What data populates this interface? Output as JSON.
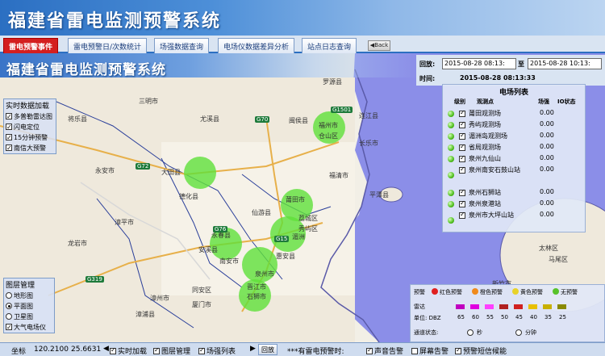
{
  "header": {
    "title": "福建省雷电监测预警系统"
  },
  "tabs": [
    {
      "label": "雷电预警事件",
      "active": true
    },
    {
      "label": "雷电预警日/次数统计"
    },
    {
      "label": "场强数据查询"
    },
    {
      "label": "电场仪数据差异分析"
    },
    {
      "label": "站点日志查询"
    }
  ],
  "back_label": "Back",
  "map": {
    "banner_title": "福建省雷电监测预警系统",
    "places": [
      "三明市",
      "尤溪县",
      "闽侯县",
      "福州市",
      "连江县",
      "仓山区",
      "长乐市",
      "大田县",
      "德化县",
      "福清市",
      "平潭县",
      "仙游县",
      "莆田市",
      "永春县",
      "荔城区",
      "南安市",
      "泉州市",
      "晋江市",
      "石狮市",
      "惠安县",
      "安溪县",
      "秀屿区",
      "同安区",
      "漳浦县",
      "湄洲",
      "漳州市",
      "厦门市",
      "龙岩市",
      "漳平市",
      "永安市",
      "罗源县",
      "将乐县",
      "仓山区",
      "太林区",
      "马尾区",
      "新竹市"
    ],
    "roads": [
      "G70",
      "G1501",
      "G72",
      "G319",
      "G15",
      "G25",
      "G76"
    ]
  },
  "realtime_panel": {
    "title": "实时数据加载",
    "items": [
      {
        "label": "多普勒雷达图",
        "checked": true
      },
      {
        "label": "闪电定位",
        "checked": true
      },
      {
        "label": "15分钟预警",
        "checked": true
      },
      {
        "label": "南信大预警",
        "checked": true
      }
    ]
  },
  "layer_panel": {
    "title": "图层管理",
    "options": [
      {
        "label": "地形图",
        "selected": false
      },
      {
        "label": "平面图",
        "selected": true
      },
      {
        "label": "卫星图",
        "selected": false
      },
      {
        "label": "大气电场仪",
        "checked": true
      }
    ]
  },
  "time": {
    "query_label": "回放:",
    "start": "2015-08-28 08:13:",
    "to_label": "至",
    "end": "2015-08-28 10:13:",
    "current_label": "时间:",
    "current": "2015-08-28 08:13:33"
  },
  "stations": {
    "title": "电场列表",
    "col_level": "级别",
    "col_name": "观测点",
    "col_field": "场强",
    "col_io": "IO状态",
    "rows": [
      {
        "name": "莆田观测场",
        "value": "0.00"
      },
      {
        "name": "秀屿观测场",
        "value": "0.00"
      },
      {
        "name": "湄洲岛观测场",
        "value": "0.00"
      },
      {
        "name": "省局观测场",
        "value": "0.00"
      },
      {
        "name": "泉州九仙山",
        "value": "0.00"
      },
      {
        "name": "泉州南安石鼓山站",
        "value": "0.00"
      },
      {
        "name": "泉州石狮站",
        "value": "0.00"
      },
      {
        "name": "泉州泉港站",
        "value": "0.00"
      },
      {
        "name": "泉州市大坪山站",
        "value": "0.00"
      }
    ]
  },
  "legend": {
    "warn_label": "预警",
    "levels": [
      {
        "label": "红色预警",
        "color": "#e02020"
      },
      {
        "label": "橙色预警",
        "color": "#f08a1c"
      },
      {
        "label": "黄色预警",
        "color": "#e8d22a"
      },
      {
        "label": "绿色预警",
        "color": "#58c22a"
      },
      {
        "label": "无预警",
        "color": "#58c22a"
      }
    ],
    "radar_label": "雷达",
    "unit_label": "单位: DBZ",
    "radar_values": [
      "65",
      "60",
      "55",
      "50",
      "45",
      "40",
      "35",
      "25"
    ],
    "radar_colors": [
      "#c000c0",
      "#e000e0",
      "#ff40ff",
      "#b02020",
      "#d02020",
      "#e8c000",
      "#c8b000",
      "#8a8a00"
    ],
    "status_label": "通道状态:",
    "second_label": "秒",
    "minute_label": "分钟"
  },
  "status": {
    "coord_label": "坐标",
    "lon": "120.2100",
    "lat": "25.6631",
    "realtime": "实时加载",
    "layer": "图层管理",
    "station_list": "场强列表",
    "replay": "回放",
    "alarm_text": "***有雷电预警时:",
    "sound": "声音告警",
    "screen": "屏幕告警",
    "sms": "预警短信候能"
  },
  "colors": {
    "accent": "#2b6fc2",
    "active_tab": "#d41f1f",
    "sea": "#8b8ee8"
  }
}
